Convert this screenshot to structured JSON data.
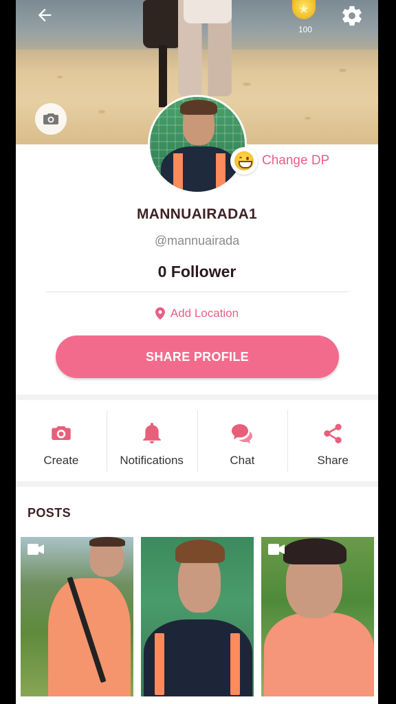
{
  "header": {
    "coins": "100"
  },
  "profile": {
    "change_dp_label": "Change DP",
    "username": "MANNUAIRADA1",
    "handle": "@mannuairada",
    "followers": "0 Follower",
    "add_location_label": "Add Location",
    "share_profile_label": "SHARE PROFILE"
  },
  "actions": [
    {
      "label": "Create",
      "icon": "camera-icon"
    },
    {
      "label": "Notifications",
      "icon": "bell-icon"
    },
    {
      "label": "Chat",
      "icon": "chat-icon"
    },
    {
      "label": "Share",
      "icon": "share-icon"
    }
  ],
  "posts": {
    "title": "POSTS",
    "items": [
      {
        "type": "video"
      },
      {
        "type": "image"
      },
      {
        "type": "video"
      }
    ]
  },
  "colors": {
    "accent": "#f36b8c",
    "accent_text": "#e85f85",
    "title_text": "#3e2226"
  }
}
